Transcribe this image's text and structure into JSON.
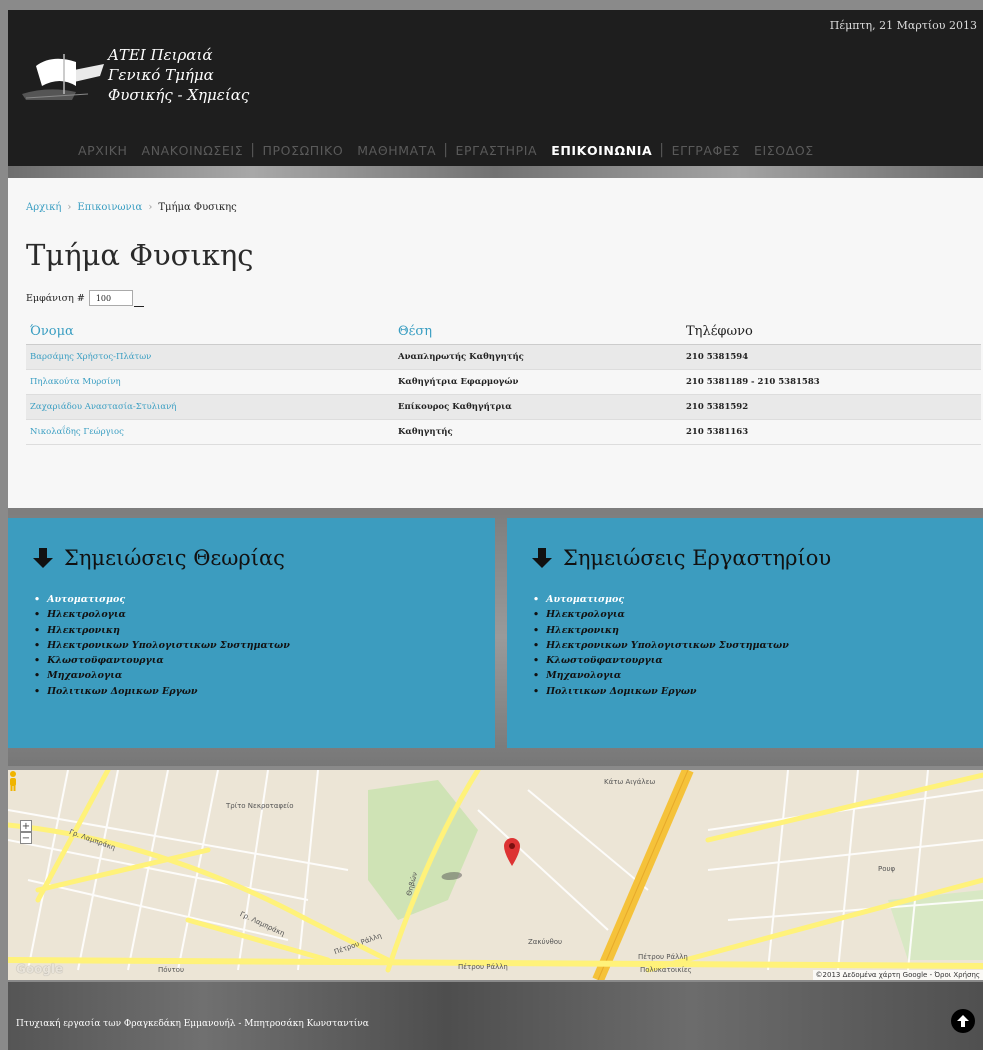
{
  "header": {
    "logo_lines": [
      "ΑΤΕΙ Πειραιά",
      "Γενικό Τμήμα",
      "Φυσικής - Χημείας"
    ],
    "date": "Πέμπτη, 21 Μαρτίου 2013"
  },
  "nav": {
    "items": [
      {
        "label": "ΑΡΧΙΚΗ"
      },
      {
        "label": "ΑΝΑΚΟΙΝΩΣΕΙΣ"
      },
      {
        "label": "ΠΡΟΣΩΠΙΚΟ"
      },
      {
        "label": "ΜΑΘΗΜΑΤΑ"
      },
      {
        "label": "ΕΡΓΑΣΤΗΡΙΑ"
      },
      {
        "label": "ΕΠΙΚΟΙΝΩΝΙΑ",
        "active": true
      },
      {
        "label": "ΕΓΓΡΑΦΕΣ"
      },
      {
        "label": "ΕΙΣΟΔΟΣ"
      }
    ]
  },
  "breadcrumb": {
    "home": "Αρχική",
    "contact": "Επικοινωνια",
    "current": "Τμήμα Φυσικης"
  },
  "page": {
    "title": "Τμήμα Φυσικης",
    "show_label": "Εμφάνιση #",
    "show_value": "100"
  },
  "table": {
    "headers": [
      "Όνομα",
      "Θέση",
      "Τηλέφωνο"
    ],
    "rows": [
      {
        "name": "Βαρσάμης Χρήστος-Πλάτων",
        "position": "Αναπληρωτής Καθηγητής",
        "phone": "210 5381594"
      },
      {
        "name": "Πηλακούτα Μυρσίνη",
        "position": "Καθηγήτρια Εφαρμογών",
        "phone": "210 5381189 - 210 5381583"
      },
      {
        "name": "Ζαχαριάδου Αναστασία-Στυλιανή",
        "position": "Επίκουρος Καθηγήτρια",
        "phone": "210 5381592"
      },
      {
        "name": "Νικολαΐδης Γεώργιος",
        "position": "Καθηγητής",
        "phone": "210 5381163"
      }
    ]
  },
  "notes": {
    "theory": {
      "title": "Σημειώσεις Θεωρίας",
      "items": [
        "Αυτοματισμος",
        "Ηλεκτρολογια",
        "Ηλεκτρονικη",
        "Ηλεκτρονικων Υπολογιστικων Συστηματων",
        "Κλωστοϋφαντουργια",
        "Μηχανολογια",
        "Πολιτικων Δομικων Εργων"
      ]
    },
    "lab": {
      "title": "Σημειώσεις Εργαστηρίου",
      "items": [
        "Αυτοματισμος",
        "Ηλεκτρολογια",
        "Ηλεκτρονικη",
        "Ηλεκτρονικων Υπολογιστικων Συστηματων",
        "Κλωστοϋφαντουργια",
        "Μηχανολογια",
        "Πολιτικων Δομικων Εργων"
      ]
    }
  },
  "map": {
    "labels": {
      "cemetery": "Τρίτο Νεκροταφείο",
      "kato_agaleo": "Κάτω Αιγάλεω",
      "petrou_ralli_1": "Πέτρου Ράλλη",
      "petrou_ralli_2": "Πέτρου Ράλλη",
      "petrou_ralli_3": "Πέτρου Ράλλη",
      "polykatoikies": "Πολυκατοικίες",
      "rouf": "Ρουφ",
      "thivon": "Θηβών",
      "pontou": "Πόντου",
      "gr_lampraki_1": "Γρ. Λαμπράκη",
      "gr_lampraki_2": "Γρ. Λαμπράκη",
      "zakinthou": "Ζακύνθου",
      "google": "Google",
      "copyright": "©2013 Δεδομένα χάρτη Google - Όροι Χρήσης"
    },
    "zoom_in": "+",
    "zoom_out": "−"
  },
  "footer": {
    "text": "Πτυχιακή εργασία των Φραγκεδάκη Εμμανουήλ - Μπητροσάκη Κωνσταντίνα"
  },
  "colors": {
    "accent": "#3c9cbf",
    "header_bg": "#1e1e1e",
    "content_bg": "#f7f7f7",
    "map_road_major": "#f5c23a",
    "map_road_minor": "#fff27a"
  }
}
